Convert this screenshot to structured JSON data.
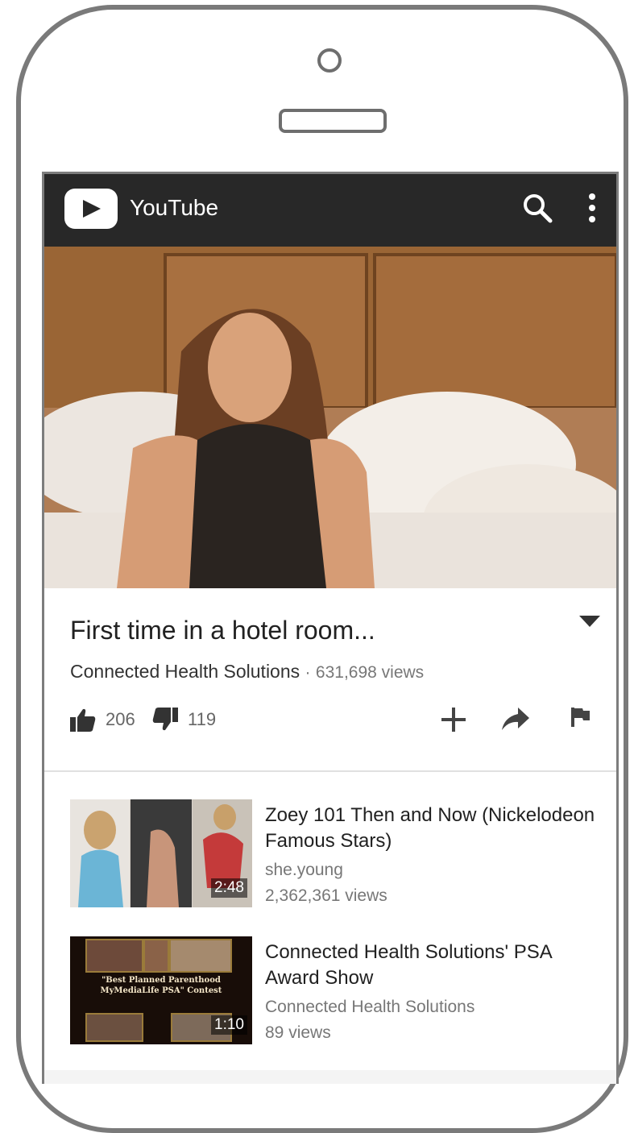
{
  "app": {
    "title": "YouTube"
  },
  "topbar": {
    "search_icon": "search-icon",
    "more_icon": "more-vert-icon"
  },
  "video": {
    "title": "First time in a hotel room...",
    "channel": "Connected Health Solutions",
    "separator": "·",
    "views": "631,698 views",
    "likes": "206",
    "dislikes": "119"
  },
  "actions": {
    "add_icon": "add-to-playlist-icon",
    "share_icon": "share-icon",
    "flag_icon": "flag-icon"
  },
  "related": [
    {
      "title": "Zoey 101 Then and Now (Nickelodeon Famous Stars)",
      "channel": "she.young",
      "views": "2,362,361 views",
      "duration": "2:48"
    },
    {
      "title": "Connected Health Solutions' PSA Award Show",
      "channel": "Connected Health Solutions",
      "views": "89 views",
      "duration": "1:10",
      "thumb_caption": "\"Best Planned Parenthood MyMediaLife PSA\" Contest"
    }
  ],
  "colors": {
    "topbar": "#282828",
    "text": "#212121",
    "secondary": "#777777"
  }
}
